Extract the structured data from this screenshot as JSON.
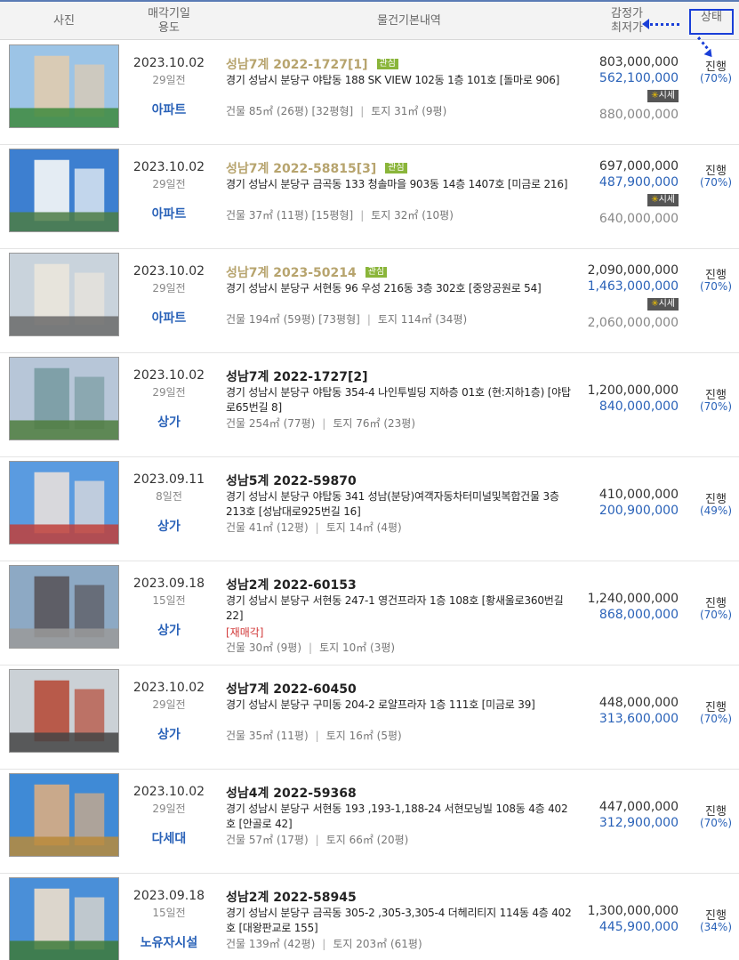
{
  "header": {
    "photo": "사진",
    "date_line1": "매각기일",
    "date_line2": "용도",
    "info": "물건기본내역",
    "price_line1": "감정가",
    "price_line2": "최저가",
    "status": "상태"
  },
  "items": [
    {
      "date": "2023.10.02",
      "ago": "29일전",
      "use": "아파트",
      "case": "성남7계 2022-1727[1]",
      "interest": "관심",
      "addr": "경기 성남시 분당구 야탑동 188 SK VIEW 102동 1층 101호 [돌마로 906]",
      "resale": "",
      "area": "건물 85㎡ (26평) [32평형]",
      "land": "토지 31㎡ (9평)",
      "appraise": "803,000,000",
      "minprice": "562,100,000",
      "sise": "시세",
      "market": "880,000,000",
      "status": "진행",
      "pct": "(70%)"
    },
    {
      "date": "2023.10.02",
      "ago": "29일전",
      "use": "아파트",
      "case": "성남7계 2022-58815[3]",
      "interest": "관심",
      "addr": "경기 성남시 분당구 금곡동 133 청솔마을 903동 14층 1407호 [미금로 216]",
      "resale": "",
      "area": "건물 37㎡ (11평) [15평형]",
      "land": "토지 32㎡ (10평)",
      "appraise": "697,000,000",
      "minprice": "487,900,000",
      "sise": "시세",
      "market": "640,000,000",
      "status": "진행",
      "pct": "(70%)"
    },
    {
      "date": "2023.10.02",
      "ago": "29일전",
      "use": "아파트",
      "case": "성남7계 2023-50214",
      "interest": "관심",
      "addr": "경기 성남시 분당구 서현동 96 우성 216동 3층 302호 [중앙공원로 54]",
      "resale": "",
      "area": "건물 194㎡ (59평) [73평형]",
      "land": "토지 114㎡ (34평)",
      "appraise": "2,090,000,000",
      "minprice": "1,463,000,000",
      "sise": "시세",
      "market": "2,060,000,000",
      "status": "진행",
      "pct": "(70%)"
    },
    {
      "date": "2023.10.02",
      "ago": "29일전",
      "use": "상가",
      "case": "성남7계 2022-1727[2]",
      "interest": "",
      "addr": "경기 성남시 분당구 야탑동 354-4 나인투빌딩 지하층 01호 (현:지하1층) [야탑로65번길 8]",
      "resale": "",
      "area": "건물 254㎡ (77평)",
      "land": "토지 76㎡ (23평)",
      "appraise": "1,200,000,000",
      "minprice": "840,000,000",
      "sise": "",
      "market": "",
      "status": "진행",
      "pct": "(70%)"
    },
    {
      "date": "2023.09.11",
      "ago": "8일전",
      "use": "상가",
      "case": "성남5계 2022-59870",
      "interest": "",
      "addr": "경기 성남시 분당구 야탑동 341 성남(분당)여객자동차터미널및복합건물 3층 213호 [성남대로925번길 16]",
      "resale": "",
      "area": "건물 41㎡ (12평)",
      "land": "토지 14㎡ (4평)",
      "appraise": "410,000,000",
      "minprice": "200,900,000",
      "sise": "",
      "market": "",
      "status": "진행",
      "pct": "(49%)"
    },
    {
      "date": "2023.09.18",
      "ago": "15일전",
      "use": "상가",
      "case": "성남2계 2022-60153",
      "interest": "",
      "addr": "경기 성남시 분당구 서현동 247-1 영건프라자 1층 108호 [황새울로360번길 22]",
      "resale": "[재매각]",
      "area": "건물 30㎡ (9평)",
      "land": "토지 10㎡ (3평)",
      "appraise": "1,240,000,000",
      "minprice": "868,000,000",
      "sise": "",
      "market": "",
      "status": "진행",
      "pct": "(70%)"
    },
    {
      "date": "2023.10.02",
      "ago": "29일전",
      "use": "상가",
      "case": "성남7계 2022-60450",
      "interest": "",
      "addr": "경기 성남시 분당구 구미동 204-2 로얄프라자 1층 111호 [미금로 39]",
      "resale": "",
      "area": "건물 35㎡ (11평)",
      "land": "토지 16㎡ (5평)",
      "appraise": "448,000,000",
      "minprice": "313,600,000",
      "sise": "",
      "market": "",
      "status": "진행",
      "pct": "(70%)"
    },
    {
      "date": "2023.10.02",
      "ago": "29일전",
      "use": "다세대",
      "case": "성남4계 2022-59368",
      "interest": "",
      "addr": "경기 성남시 분당구 서현동 193 ,193-1,188-24 서현모닝빌 108동 4층 402호 [안골로 42]",
      "resale": "",
      "area": "건물 57㎡ (17평)",
      "land": "토지 66㎡ (20평)",
      "appraise": "447,000,000",
      "minprice": "312,900,000",
      "sise": "",
      "market": "",
      "status": "진행",
      "pct": "(70%)"
    },
    {
      "date": "2023.09.18",
      "ago": "15일전",
      "use": "노유자시설",
      "case": "성남2계 2022-58945",
      "interest": "",
      "addr": "경기 성남시 분당구 금곡동 305-2 ,305-3,305-4 더헤리티지 114동 4층 402호 [대왕판교로 155]",
      "resale": "",
      "area": "건물 139㎡ (42평)",
      "land": "토지 203㎡ (61평)",
      "appraise": "1,300,000,000",
      "minprice": "445,900,000",
      "sise": "",
      "market": "",
      "status": "진행",
      "pct": "(34%)"
    }
  ]
}
